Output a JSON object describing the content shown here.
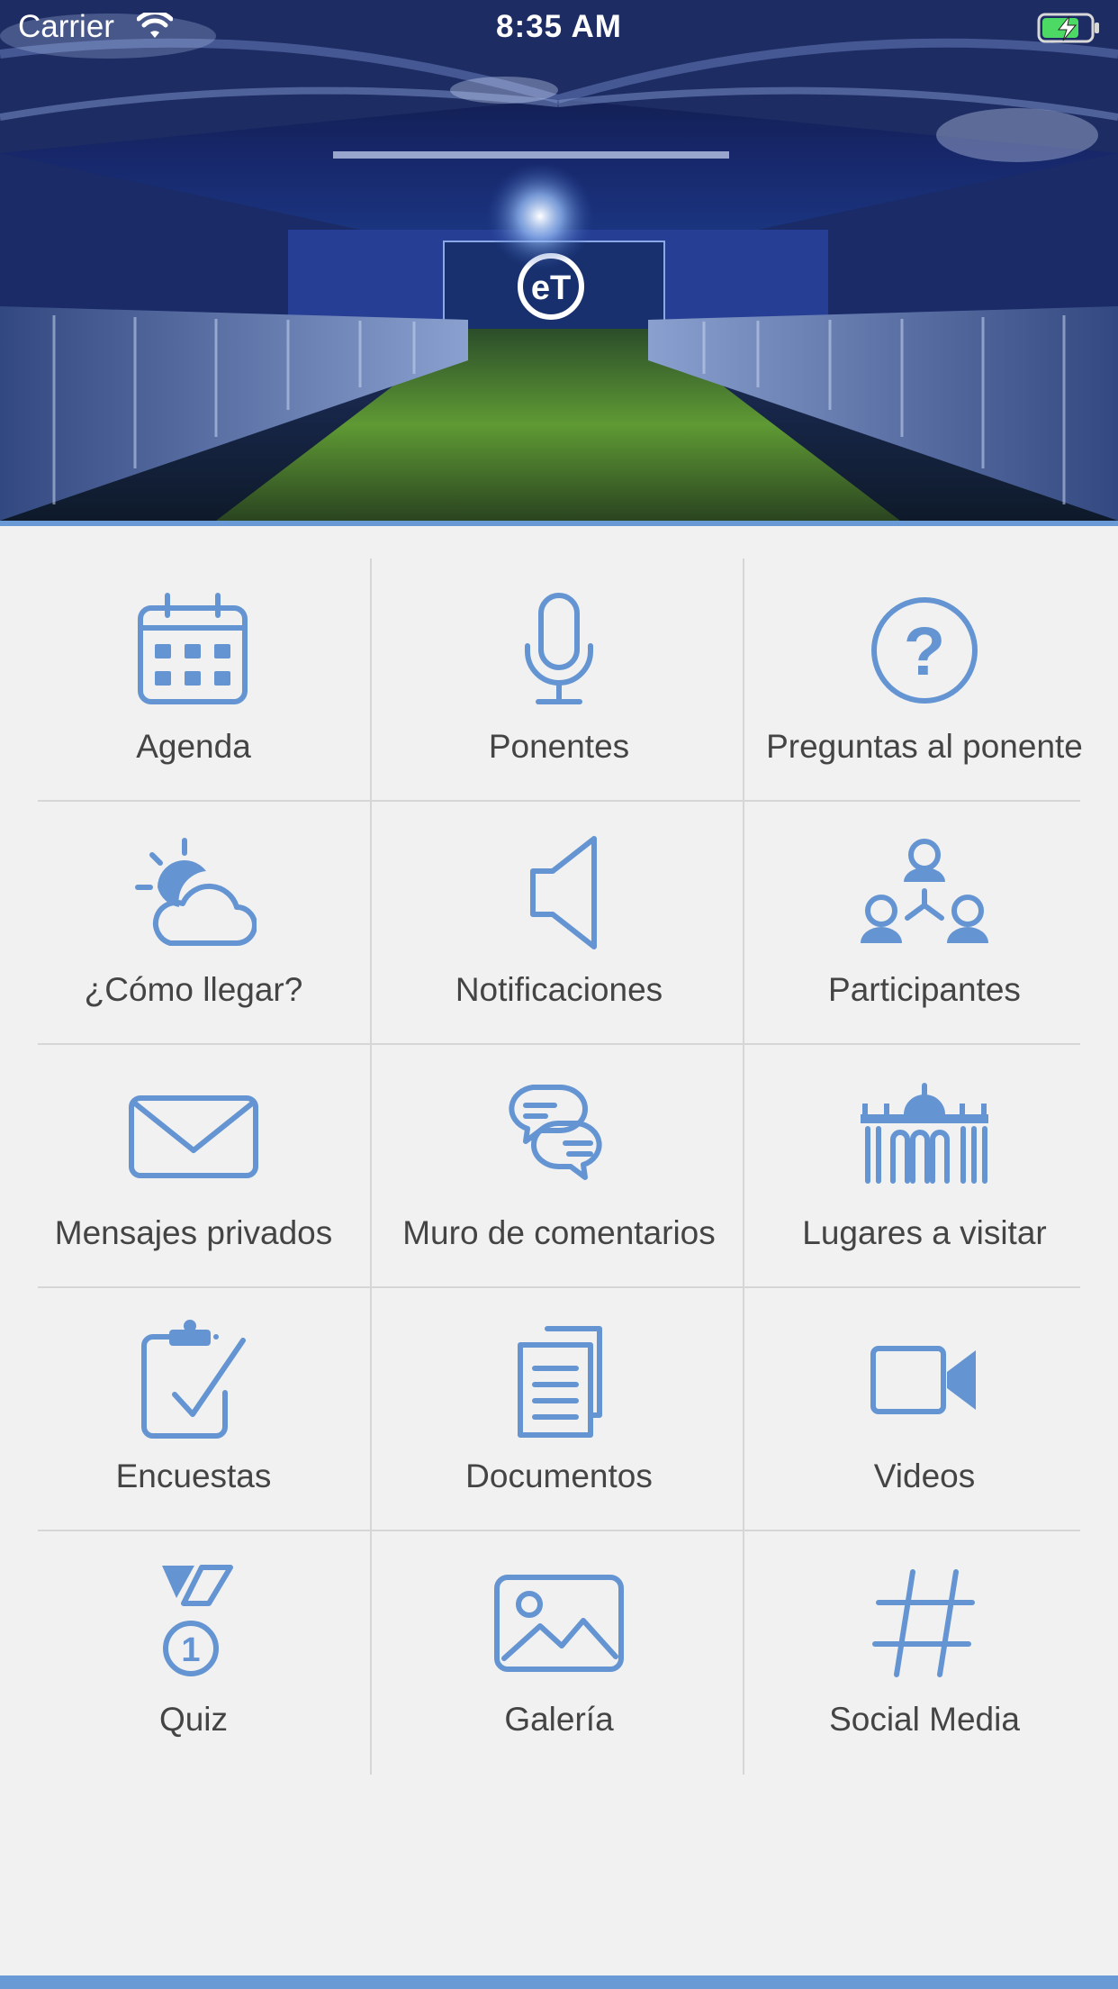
{
  "status_bar": {
    "carrier": "Carrier",
    "time": "8:35 AM",
    "battery_state": "charging"
  },
  "hero": {
    "description_icon": "event-venue-photo",
    "logo_text": "eT"
  },
  "colors": {
    "accent": "#6495d2",
    "divider": "#d6d6d6",
    "background": "#f1f1f2",
    "label_text": "#444444"
  },
  "menu": {
    "items": [
      {
        "label": "Agenda",
        "icon": "calendar-icon"
      },
      {
        "label": "Ponentes",
        "icon": "microphone-icon"
      },
      {
        "label": "Preguntas al ponente",
        "icon": "question-icon"
      },
      {
        "label": "¿Cómo llegar?",
        "icon": "weather-icon"
      },
      {
        "label": "Notificaciones",
        "icon": "megaphone-icon"
      },
      {
        "label": "Participantes",
        "icon": "network-icon"
      },
      {
        "label": "Mensajes privados",
        "icon": "envelope-icon"
      },
      {
        "label": "Muro de comentarios",
        "icon": "chat-bubbles-icon"
      },
      {
        "label": "Lugares a visitar",
        "icon": "landmark-icon"
      },
      {
        "label": "Encuestas",
        "icon": "clipboard-check-icon"
      },
      {
        "label": "Documentos",
        "icon": "documents-icon"
      },
      {
        "label": "Videos",
        "icon": "video-camera-icon"
      },
      {
        "label": "Quiz",
        "icon": "medal-icon"
      },
      {
        "label": "Galería",
        "icon": "image-icon"
      },
      {
        "label": "Social Media",
        "icon": "hashtag-icon"
      }
    ]
  }
}
